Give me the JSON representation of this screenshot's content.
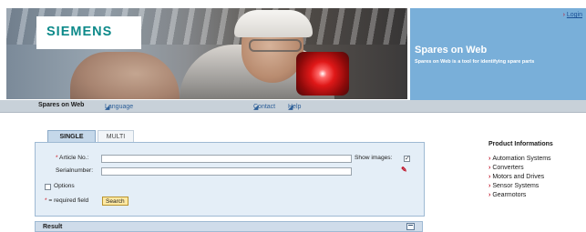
{
  "header": {
    "logo_text": "SIEMENS",
    "login_label": "Login",
    "title": "Spares on Web",
    "subtitle": "Spares on Web is a tool for identifying spare parts"
  },
  "nav": {
    "home": "Spares on Web",
    "language": "Language",
    "contact": "Contact",
    "help": "Help"
  },
  "tabs": [
    {
      "label": "SINGLE",
      "active": true
    },
    {
      "label": "MULTI",
      "active": false
    }
  ],
  "form": {
    "article_label": "Article No.:",
    "article_value": "",
    "serial_label": "Serialnumber:",
    "serial_value": "",
    "show_images_label": "Show images:",
    "show_images_checked": true,
    "options_label": "Options",
    "options_checked": false,
    "required_hint": "= required field",
    "search_button": "Search"
  },
  "result": {
    "title": "Result"
  },
  "product_info": {
    "heading": "Product Informations",
    "items": [
      "Automation Systems",
      "Converters",
      "Motors and Drives",
      "Sensor Systems",
      "Gearmotors"
    ]
  },
  "colors": {
    "brand_teal": "#0e8a8a",
    "header_blue": "#79afd9",
    "accent_red": "#c0152a",
    "form_bg": "#e4eef7"
  }
}
